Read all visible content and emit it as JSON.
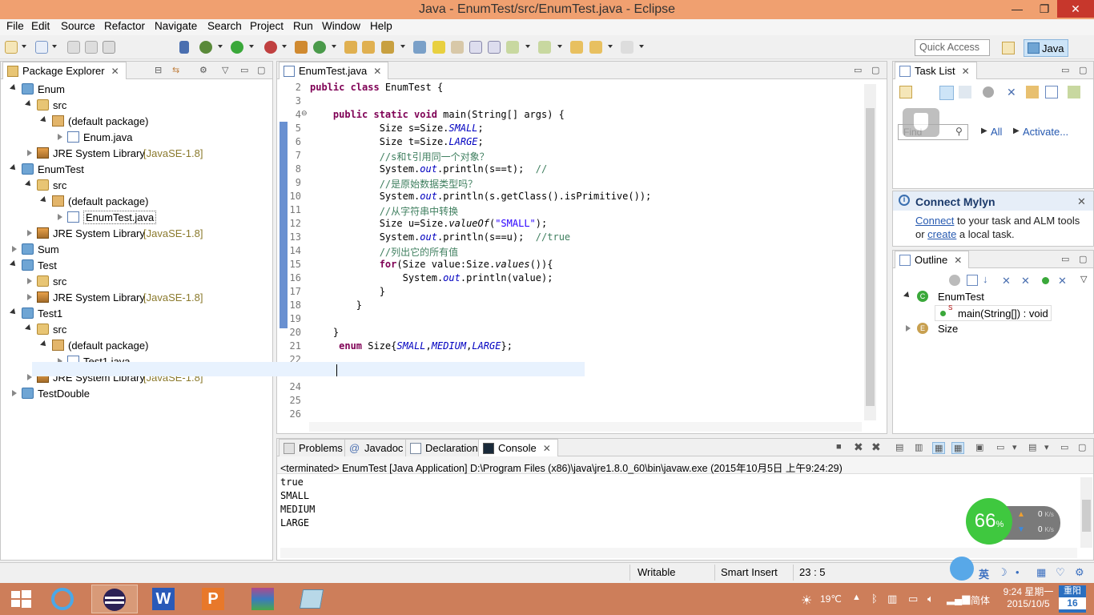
{
  "window": {
    "title": "Java - EnumTest/src/EnumTest.java - Eclipse",
    "minimize": "—",
    "restore": "❐",
    "close": "✕"
  },
  "menu": [
    "File",
    "Edit",
    "Source",
    "Refactor",
    "Navigate",
    "Search",
    "Project",
    "Run",
    "Window",
    "Help"
  ],
  "toolbar": {
    "quick_access_placeholder": "Quick Access",
    "perspective": "Java"
  },
  "package_explorer": {
    "tab": "Package Explorer",
    "tree": [
      {
        "label": "Enum",
        "type": "project",
        "depth": 0,
        "state": "open"
      },
      {
        "label": "src",
        "type": "src",
        "depth": 1,
        "state": "open"
      },
      {
        "label": "(default package)",
        "type": "pkg",
        "depth": 2,
        "state": "open"
      },
      {
        "label": "Enum.java",
        "type": "java",
        "depth": 3,
        "state": "closed"
      },
      {
        "label": "JRE System Library",
        "suffix": "[JavaSE-1.8]",
        "type": "jre",
        "depth": 1,
        "state": "closed"
      },
      {
        "label": "EnumTest",
        "type": "project",
        "depth": 0,
        "state": "open"
      },
      {
        "label": "src",
        "type": "src",
        "depth": 1,
        "state": "open"
      },
      {
        "label": "(default package)",
        "type": "pkg",
        "depth": 2,
        "state": "open"
      },
      {
        "label": "EnumTest.java",
        "type": "java",
        "depth": 3,
        "state": "closed",
        "selected": true
      },
      {
        "label": "JRE System Library",
        "suffix": "[JavaSE-1.8]",
        "type": "jre",
        "depth": 1,
        "state": "closed"
      },
      {
        "label": "Sum",
        "type": "project",
        "depth": 0,
        "state": "closed"
      },
      {
        "label": "Test",
        "type": "project",
        "depth": 0,
        "state": "open"
      },
      {
        "label": "src",
        "type": "src",
        "depth": 1,
        "state": "closed"
      },
      {
        "label": "JRE System Library",
        "suffix": "[JavaSE-1.8]",
        "type": "jre",
        "depth": 1,
        "state": "closed"
      },
      {
        "label": "Test1",
        "type": "project",
        "depth": 0,
        "state": "open"
      },
      {
        "label": "src",
        "type": "src",
        "depth": 1,
        "state": "open"
      },
      {
        "label": "(default package)",
        "type": "pkg",
        "depth": 2,
        "state": "open"
      },
      {
        "label": "Test1.java",
        "type": "java",
        "depth": 3,
        "state": "closed"
      },
      {
        "label": "JRE System Library",
        "suffix": "[JavaSE-1.8]",
        "type": "jre",
        "depth": 1,
        "state": "closed"
      },
      {
        "label": "TestDouble",
        "type": "project",
        "depth": 0,
        "state": "closed"
      }
    ]
  },
  "editor": {
    "tab": "EnumTest.java",
    "lines": [
      {
        "n": "2",
        "html": "<span class=\"kw\">public class</span> EnumTest {"
      },
      {
        "n": "3",
        "html": ""
      },
      {
        "n": "4",
        "html": "    <span class=\"kw\">public static void</span> main(String[] args) {"
      },
      {
        "n": "5",
        "html": "            Size s=Size.<span class=\"fld\">SMALL</span>;"
      },
      {
        "n": "6",
        "html": "            Size t=Size.<span class=\"fld\">LARGE</span>;"
      },
      {
        "n": "7",
        "html": "            <span class=\"cmt\">//s和t引用同一个对象？</span>"
      },
      {
        "n": "8",
        "html": "            System.<span class=\"fld\">out</span>.println(s==t);  <span class=\"cmt\">//</span>"
      },
      {
        "n": "9",
        "html": "            <span class=\"cmt\">//是原始数据类型吗？</span>"
      },
      {
        "n": "10",
        "html": "            System.<span class=\"fld\">out</span>.println(s.getClass().isPrimitive());"
      },
      {
        "n": "11",
        "html": "            <span class=\"cmt\">//从字符串中转换</span>"
      },
      {
        "n": "12",
        "html": "            Size u=Size.<span class=\"mi\">valueOf</span>(<span class=\"str\">\"SMALL\"</span>);"
      },
      {
        "n": "13",
        "html": "            System.<span class=\"fld\">out</span>.println(s==u);  <span class=\"cmt\">//true</span>"
      },
      {
        "n": "14",
        "html": "            <span class=\"cmt\">//列出它的所有值</span>"
      },
      {
        "n": "15",
        "html": "            <span class=\"kw\">for</span>(Size value:Size.<span class=\"mi\">values</span>()){"
      },
      {
        "n": "16",
        "html": "                System.<span class=\"fld\">out</span>.println(value);"
      },
      {
        "n": "17",
        "html": "            }"
      },
      {
        "n": "18",
        "html": "        }"
      },
      {
        "n": "19",
        "html": ""
      },
      {
        "n": "20",
        "html": "    }"
      },
      {
        "n": "21",
        "html": "     <span class=\"kw\">enum</span> Size{<span class=\"fld\">SMALL</span>,<span class=\"fld\">MEDIUM</span>,<span class=\"fld\">LARGE</span>};"
      },
      {
        "n": "22",
        "html": ""
      },
      {
        "n": "23",
        "html": ""
      },
      {
        "n": "24",
        "html": ""
      },
      {
        "n": "25",
        "html": ""
      },
      {
        "n": "26",
        "html": ""
      }
    ]
  },
  "task_list": {
    "tab": "Task List",
    "find_placeholder": "Find",
    "all": "All",
    "activate": "Activate..."
  },
  "mylyn": {
    "title": "Connect Mylyn",
    "connect": "Connect",
    "text1": " to your task and ALM tools",
    "or": "or ",
    "create": "create",
    "text2": " a local task."
  },
  "outline": {
    "tab": "Outline",
    "items": [
      {
        "label": "EnumTest",
        "depth": 0,
        "state": "open"
      },
      {
        "label": "main(String[]) : void",
        "depth": 1,
        "state": "none"
      },
      {
        "label": "Size",
        "depth": 0,
        "state": "closed"
      }
    ]
  },
  "bottom": {
    "tabs": [
      "Problems",
      "Javadoc",
      "Declaration",
      "Console"
    ],
    "terminated": "<terminated> EnumTest [Java Application] D:\\Program Files (x86)\\java\\jre1.8.0_60\\bin\\javaw.exe (2015年10月5日 上午9:24:29)",
    "output": [
      "true",
      "SMALL",
      "MEDIUM",
      "LARGE"
    ]
  },
  "status": {
    "writable": "Writable",
    "insert": "Smart Insert",
    "position": "23 : 5"
  },
  "net_widget": {
    "percent": "66",
    "unit": "%",
    "up": "0",
    "down": "0",
    "rate_unit": "K/s"
  },
  "ime": {
    "lang": "英"
  },
  "tray": {
    "weather": "19℃",
    "ime_mode": "简体",
    "time": "9:24 星期一",
    "date": "2015/10/5",
    "cal_top": "重阳",
    "cal_day": "16"
  }
}
